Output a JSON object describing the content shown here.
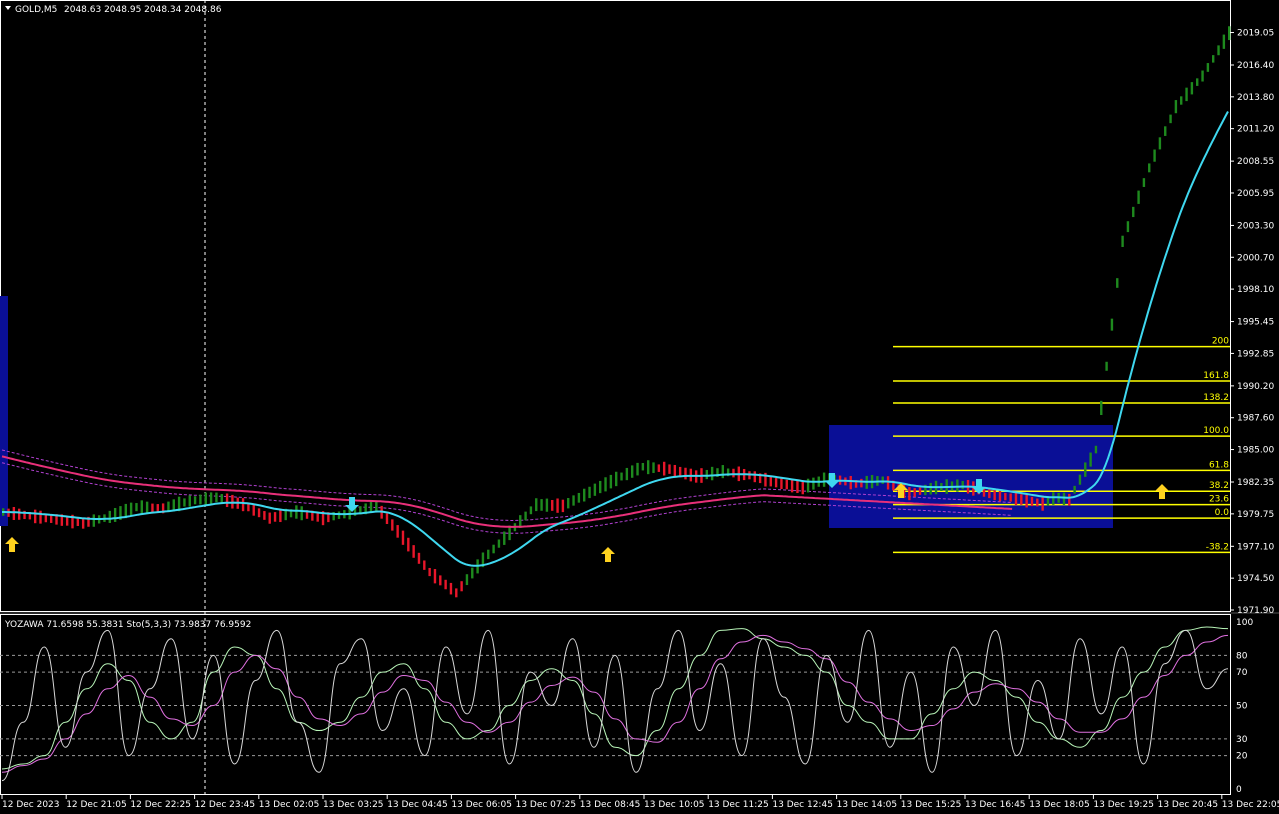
{
  "main_header": {
    "symbol": "GOLD,M5",
    "ohlc": "2048.63 2048.95 2048.34 2048.86"
  },
  "sub_header": {
    "text": "YOZAWA 71.6598 55.3831  Sto(5,3,3) 73.9837 76.9592"
  },
  "colors": {
    "bull": "#1e8a1e",
    "bear": "#e8162a",
    "ma_fast": "#3fd8f0",
    "ma_slow": "#e8307a",
    "fib": "#ffff00",
    "box": "#0a0f96",
    "stoch_main": "#b8f5b8",
    "stoch_signal": "#e070e0",
    "yozawa": "#d8d8d8"
  },
  "chart_data": [
    {
      "type": "candlestick",
      "title": "GOLD,M5",
      "y_ticks": [
        "2019.05",
        "2016.40",
        "2013.80",
        "2011.20",
        "2008.55",
        "2005.95",
        "2003.30",
        "2000.70",
        "1998.10",
        "1995.45",
        "1992.85",
        "1990.20",
        "1987.60",
        "1985.00",
        "1982.35",
        "1979.75",
        "1977.10",
        "1974.50",
        "1971.90"
      ],
      "ylim": [
        1971.9,
        2020.4
      ],
      "x_ticks": [
        "12 Dec 2023",
        "12 Dec 21:05",
        "12 Dec 22:25",
        "12 Dec 23:45",
        "13 Dec 02:05",
        "13 Dec 03:25",
        "13 Dec 04:45",
        "13 Dec 06:05",
        "13 Dec 07:25",
        "13 Dec 08:45",
        "13 Dec 10:05",
        "13 Dec 11:25",
        "13 Dec 12:45",
        "13 Dec 14:05",
        "13 Dec 15:25",
        "13 Dec 16:45",
        "13 Dec 18:05",
        "13 Dec 19:25",
        "13 Dec 20:45",
        "13 Dec 22:05"
      ],
      "series": [
        {
          "values": [
            [
              0,
              1979.9
            ],
            [
              10,
              1979.6
            ],
            [
              20,
              1979.3
            ],
            [
              30,
              1979.0
            ],
            [
              40,
              1979.5
            ],
            [
              50,
              1980.3
            ],
            [
              60,
              1980.2
            ],
            [
              70,
              1980.8
            ],
            [
              80,
              1981.1
            ],
            [
              90,
              1980.5
            ],
            [
              100,
              1979.4
            ],
            [
              110,
              1979.9
            ],
            [
              120,
              1979.4
            ],
            [
              130,
              1979.8
            ],
            [
              140,
              1980.4
            ],
            [
              150,
              1977.8
            ],
            [
              160,
              1975.0
            ],
            [
              170,
              1973.3
            ],
            [
              180,
              1976.0
            ],
            [
              190,
              1978.2
            ],
            [
              200,
              1980.5
            ],
            [
              210,
              1980.4
            ],
            [
              220,
              1981.5
            ],
            [
              230,
              1982.6
            ],
            [
              240,
              1983.6
            ],
            [
              250,
              1983.4
            ],
            [
              260,
              1982.8
            ],
            [
              270,
              1983.2
            ],
            [
              280,
              1982.9
            ],
            [
              290,
              1982.3
            ],
            [
              300,
              1981.9
            ],
            [
              310,
              1982.7
            ],
            [
              320,
              1982.2
            ],
            [
              330,
              1982.5
            ],
            [
              340,
              1981.4
            ],
            [
              350,
              1981.9
            ],
            [
              360,
              1982.1
            ],
            [
              370,
              1981.4
            ],
            [
              380,
              1981.0
            ],
            [
              390,
              1980.6
            ],
            [
              395,
              1981.1
            ],
            [
              400,
              1980.9
            ],
            [
              410,
              1985.0
            ],
            [
              420,
              2002.0
            ],
            [
              430,
              2008.0
            ],
            [
              440,
              2013.0
            ],
            [
              450,
              2015.5
            ],
            [
              460,
              2019.0
            ]
          ]
        }
      ]
    },
    {
      "type": "line",
      "title": "YOZAWA 71.6598 55.3831  Sto(5,3,3) 73.9837 76.9592",
      "y_ticks": [
        "100",
        "80",
        "70",
        "50",
        "30",
        "20",
        "0"
      ],
      "ylim": [
        0,
        100
      ],
      "levels": [
        80,
        70,
        50,
        30,
        20
      ],
      "series": [
        {
          "name": "Sto(5,3,3)",
          "values": [
            12,
            15,
            20,
            40,
            60,
            75,
            65,
            40,
            30,
            40,
            70,
            85,
            80,
            60,
            40,
            35,
            40,
            55,
            70,
            75,
            60,
            40,
            30,
            35,
            50,
            65,
            72,
            65,
            45,
            25,
            20,
            35,
            60,
            80,
            95,
            96,
            90,
            85,
            80,
            70,
            50,
            40,
            30,
            30,
            45,
            60,
            70,
            65,
            55,
            40,
            30,
            25,
            35,
            55,
            70,
            85,
            95,
            97,
            96
          ]
        },
        {
          "name": "signal",
          "values": [
            10,
            14,
            18,
            30,
            45,
            60,
            68,
            55,
            42,
            38,
            50,
            70,
            80,
            72,
            55,
            42,
            38,
            45,
            58,
            68,
            65,
            52,
            40,
            34,
            40,
            52,
            62,
            67,
            58,
            42,
            30,
            28,
            40,
            60,
            78,
            88,
            92,
            88,
            84,
            78,
            64,
            52,
            42,
            35,
            38,
            48,
            58,
            63,
            60,
            52,
            42,
            34,
            34,
            42,
            55,
            68,
            80,
            88,
            92
          ]
        },
        {
          "name": "YOZAWA",
          "values": [
            5,
            40,
            85,
            25,
            70,
            95,
            20,
            60,
            90,
            30,
            80,
            15,
            65,
            95,
            40,
            10,
            75,
            90,
            35,
            60,
            20,
            85,
            45,
            95,
            15,
            70,
            50,
            90,
            25,
            80,
            10,
            60,
            95,
            35,
            75,
            20,
            90,
            55,
            15,
            80,
            40,
            95,
            25,
            70,
            10,
            85,
            50,
            95,
            20,
            65,
            30,
            90,
            45,
            85,
            15,
            75,
            95,
            60,
            72
          ]
        }
      ]
    }
  ],
  "overlays": {
    "fib_labels": [
      "200",
      "161.8",
      "138.2",
      "100.0",
      "61.8",
      "38.2",
      "23.6",
      "0.0",
      "-38.2"
    ],
    "fib_prices": [
      1993.4,
      1990.6,
      1988.8,
      1986.1,
      1983.3,
      1981.6,
      1980.5,
      1979.4,
      1976.6
    ]
  }
}
